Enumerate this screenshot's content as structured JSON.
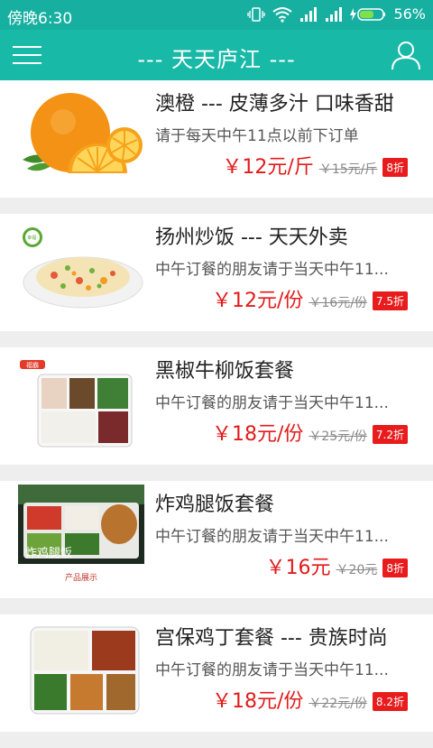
{
  "statusbar": {
    "time": "傍晚6:30",
    "battery": "56%"
  },
  "header": {
    "title": "--- 天天庐江 ---"
  },
  "items": [
    {
      "name": "澳橙 --- 皮薄多汁 口味香甜",
      "desc": "请于每天中午11点以前下订单",
      "price": "￥12元/斤",
      "old_price": "￥15元/斤",
      "discount": "8折"
    },
    {
      "name": "扬州炒饭 --- 天天外卖",
      "desc": "中午订餐的朋友请于当天中午11...",
      "price": "￥12元/份",
      "old_price": "￥16元/份",
      "discount": "7.5折"
    },
    {
      "name": "黑椒牛柳饭套餐",
      "desc": "中午订餐的朋友请于当天中午11...",
      "price": "￥18元/份",
      "old_price": "￥25元/份",
      "discount": "7.2折"
    },
    {
      "name": "炸鸡腿饭套餐",
      "desc": "中午订餐的朋友请于当天中午11...",
      "price": "￥16元",
      "old_price": "￥20元",
      "discount": "8折",
      "image_caption": "炸鸡腿饭",
      "image_subcaption": "产品展示"
    },
    {
      "name": "宫保鸡丁套餐 --- 贵族时尚",
      "desc": "中午订餐的朋友请于当天中午11...",
      "price": "￥18元/份",
      "old_price": "￥22元/份",
      "discount": "8.2折"
    }
  ],
  "image_labels": {
    "fried_rice_logo": "幸福·",
    "beef_logo": "福霸"
  }
}
